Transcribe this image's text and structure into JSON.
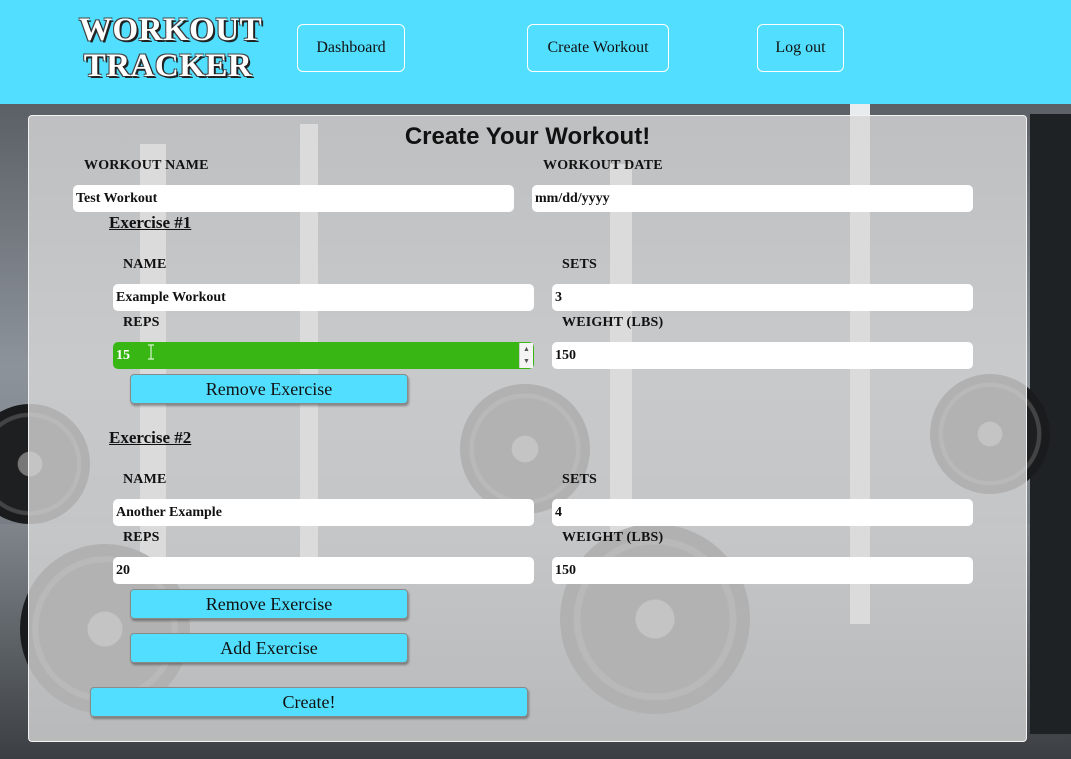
{
  "app": {
    "logo_line1": "WORKOUT",
    "logo_line2": "TRACKER"
  },
  "nav": {
    "dashboard": "Dashboard",
    "create_workout": "Create Workout",
    "logout": "Log out"
  },
  "form": {
    "title": "Create Your Workout!",
    "workout_name_label": "WORKOUT NAME",
    "workout_name_value": "Test Workout",
    "workout_date_label": "WORKOUT DATE",
    "workout_date_value": "mm/dd/yyyy",
    "exercises": [
      {
        "heading": "Exercise #1",
        "name_label": "NAME",
        "name_value": "Example Workout",
        "sets_label": "SETS",
        "sets_value": "3",
        "reps_label": "REPS",
        "reps_value": "15",
        "weight_label": "WEIGHT (LBS)",
        "weight_value": "150",
        "remove_label": "Remove Exercise"
      },
      {
        "heading": "Exercise #2",
        "name_label": "NAME",
        "name_value": "Another Example",
        "sets_label": "SETS",
        "sets_value": "4",
        "reps_label": "REPS",
        "reps_value": "20",
        "weight_label": "WEIGHT (LBS)",
        "weight_value": "150",
        "remove_label": "Remove Exercise"
      }
    ],
    "add_exercise_label": "Add Exercise",
    "create_label": "Create!"
  },
  "colors": {
    "header_bg": "#52dfff",
    "button_bg": "#52dfff",
    "focused_field_bg": "#38b613"
  }
}
